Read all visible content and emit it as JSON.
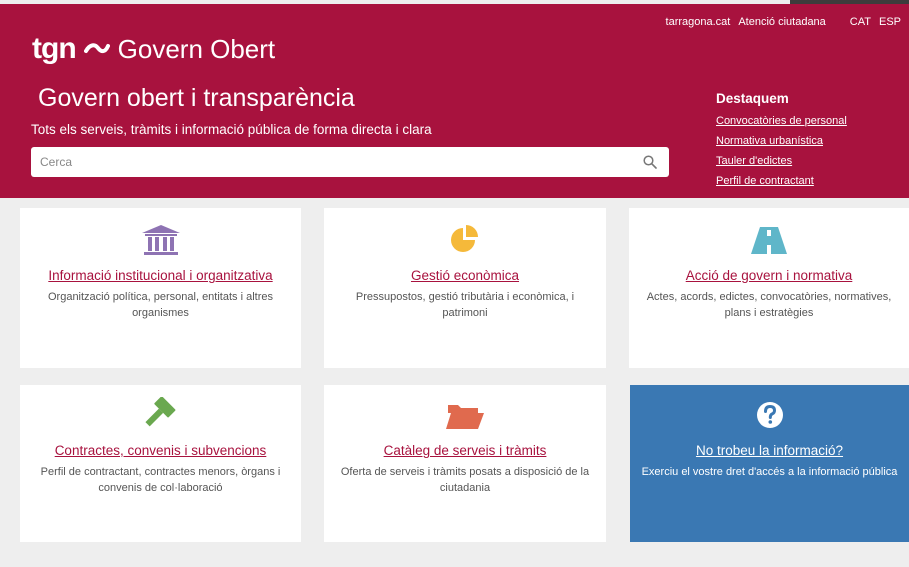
{
  "header": {
    "brand_prefix": "tgn",
    "brand_name": "Govern Obert",
    "title": "Govern obert i transparència",
    "subtitle": "Tots els serveis, tràmits i informació pública de forma directa i clara",
    "top_links": {
      "site": "tarragona.cat",
      "attention": "Atenció ciutadana",
      "lang_cat": "CAT",
      "lang_esp": "ESP"
    },
    "search": {
      "placeholder": "Cerca"
    },
    "highlights": {
      "heading": "Destaquem",
      "links": [
        "Convocatòries de personal",
        "Normativa urbanística",
        "Tauler d'edictes",
        "Perfil de contractant"
      ]
    }
  },
  "cards": [
    {
      "title": "Informació institucional i organitzativa",
      "desc": "Organització política, personal, entitats i altres organismes",
      "icon": "institution-building-icon",
      "color": "#8e73b3"
    },
    {
      "title": "Gestió econòmica",
      "desc": "Pressupostos, gestió tributària i econòmica, i patrimoni",
      "icon": "pie-chart-icon",
      "color": "#f5b93a"
    },
    {
      "title": "Acció de govern i normativa",
      "desc": "Actes, acords, edictes, convocatòries, normatives, plans i estratègies",
      "icon": "road-icon",
      "color": "#5fb6c9"
    },
    {
      "title": "Contractes, convenis i subvencions",
      "desc": "Perfil de contractant, contractes menors, òrgans i convenis de col·laboració",
      "icon": "gavel-icon",
      "color": "#6aa84f"
    },
    {
      "title": "Catàleg de serveis i tràmits",
      "desc": "Oferta de serveis i tràmits posats a disposició de la ciutadania",
      "icon": "folder-open-icon",
      "color": "#e06a4e"
    },
    {
      "title": "No trobeu la informació?",
      "desc": "Exerciu el vostre dret d'accés a la informació pública",
      "icon": "question-circle-icon",
      "color": "#ffffff"
    }
  ],
  "colors": {
    "brand": "#a8123e",
    "help_card": "#3a78b3",
    "background": "#eeeeee"
  }
}
